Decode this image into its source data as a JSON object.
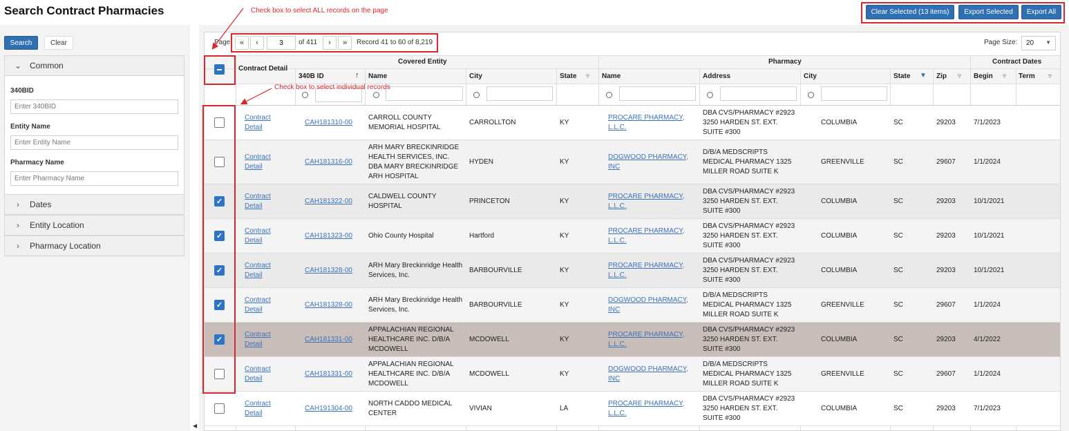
{
  "page": {
    "title": "Search Contract Pharmacies"
  },
  "toolbar": {
    "clear_selected": "Clear Selected (13 items)",
    "export_selected": "Export Selected",
    "export_all": "Export All"
  },
  "sidebar": {
    "search_label": "Search",
    "clear_label": "Clear",
    "common_label": "Common",
    "fields": {
      "bid_label": "340BID",
      "bid_placeholder": "Enter 340BID",
      "entity_label": "Entity Name",
      "entity_placeholder": "Enter Entity Name",
      "pharmacy_label": "Pharmacy Name",
      "pharmacy_placeholder": "Enter Pharmacy Name"
    },
    "sections": [
      "Dates",
      "Entity Location",
      "Pharmacy Location"
    ]
  },
  "pager": {
    "page_label": "Page",
    "current_page": "3",
    "of_label": "of 411",
    "record_label": "Record 41 to 60 of 8,219",
    "page_size_label": "Page Size:",
    "page_size": "20"
  },
  "annotations": {
    "select_all": "Check box to select ALL records on the page",
    "select_individual": "Check box to select individual records"
  },
  "table": {
    "group_headers": {
      "contract_detail": "Contract Detail",
      "covered_entity": "Covered Entity",
      "pharmacy": "Pharmacy",
      "contract_dates": "Contract Dates"
    },
    "columns": {
      "id": "340B ID",
      "ce_name": "Name",
      "ce_city": "City",
      "ce_state": "State",
      "ph_name": "Name",
      "ph_address": "Address",
      "ph_city": "City",
      "ph_state": "State",
      "ph_zip": "Zip",
      "begin": "Begin",
      "term": "Term"
    },
    "rows": [
      {
        "checked": false,
        "detail": "Contract Detail",
        "id": "CAH181310-00",
        "ce_name": "CARROLL COUNTY MEMORIAL HOSPITAL",
        "ce_city": "CARROLLTON",
        "ce_state": "KY",
        "ph_name": "PROCARE PHARMACY, L.L.C.",
        "ph_address": "DBA CVS/PHARMACY #2923 3250 HARDEN ST. EXT. SUITE #300",
        "ph_city": "COLUMBIA",
        "ph_state": "SC",
        "zip": "29203",
        "begin": "7/1/2023",
        "term": ""
      },
      {
        "checked": false,
        "detail": "Contract Detail",
        "id": "CAH181316-00",
        "ce_name": "ARH MARY BRECKINRIDGE HEALTH SERVICES, INC. DBA MARY BRECKINRIDGE ARH HOSPITAL",
        "ce_city": "HYDEN",
        "ce_state": "KY",
        "ph_name": "DOGWOOD PHARMACY, INC",
        "ph_address": "D/B/A MEDSCRIPTS MEDICAL PHARMACY 1325 MILLER ROAD SUITE K",
        "ph_city": "GREENVILLE",
        "ph_state": "SC",
        "zip": "29607",
        "begin": "1/1/2024",
        "term": ""
      },
      {
        "checked": true,
        "detail": "Contract Detail",
        "id": "CAH181322-00",
        "ce_name": "CALDWELL COUNTY HOSPITAL",
        "ce_city": "PRINCETON",
        "ce_state": "KY",
        "ph_name": "PROCARE PHARMACY, L.L.C.",
        "ph_address": "DBA CVS/PHARMACY #2923 3250 HARDEN ST. EXT. SUITE #300",
        "ph_city": "COLUMBIA",
        "ph_state": "SC",
        "zip": "29203",
        "begin": "10/1/2021",
        "term": ""
      },
      {
        "checked": true,
        "detail": "Contract Detail",
        "id": "CAH181323-00",
        "ce_name": "Ohio County Hospital",
        "ce_city": "Hartford",
        "ce_state": "KY",
        "ph_name": "PROCARE PHARMACY, L.L.C.",
        "ph_address": "DBA CVS/PHARMACY #2923 3250 HARDEN ST. EXT. SUITE #300",
        "ph_city": "COLUMBIA",
        "ph_state": "SC",
        "zip": "29203",
        "begin": "10/1/2021",
        "term": ""
      },
      {
        "checked": true,
        "detail": "Contract Detail",
        "id": "CAH181328-00",
        "ce_name": "ARH Mary Breckinridge Health Services, Inc.",
        "ce_city": "BARBOURVILLE",
        "ce_state": "KY",
        "ph_name": "PROCARE PHARMACY, L.L.C.",
        "ph_address": "DBA CVS/PHARMACY #2923 3250 HARDEN ST. EXT. SUITE #300",
        "ph_city": "COLUMBIA",
        "ph_state": "SC",
        "zip": "29203",
        "begin": "10/1/2021",
        "term": ""
      },
      {
        "checked": true,
        "detail": "Contract Detail",
        "id": "CAH181328-00",
        "ce_name": "ARH Mary Breckinridge Health Services, Inc.",
        "ce_city": "BARBOURVILLE",
        "ce_state": "KY",
        "ph_name": "DOGWOOD PHARMACY, INC",
        "ph_address": "D/B/A MEDSCRIPTS MEDICAL PHARMACY 1325 MILLER ROAD SUITE K",
        "ph_city": "GREENVILLE",
        "ph_state": "SC",
        "zip": "29607",
        "begin": "1/1/2024",
        "term": ""
      },
      {
        "checked": true,
        "detail": "Contract Detail",
        "id": "CAH181331-00",
        "ce_name": "APPALACHIAN REGIONAL HEALTHCARE INC. D/B/A MCDOWELL",
        "ce_city": "MCDOWELL",
        "ce_state": "KY",
        "ph_name": "PROCARE PHARMACY, L.L.C.",
        "ph_address": "DBA CVS/PHARMACY #2923 3250 HARDEN ST. EXT. SUITE #300",
        "ph_city": "COLUMBIA",
        "ph_state": "SC",
        "zip": "29203",
        "begin": "4/1/2022",
        "term": ""
      },
      {
        "checked": false,
        "detail": "Contract Detail",
        "id": "CAH181331-00",
        "ce_name": "APPALACHIAN REGIONAL HEALTHCARE INC. D/B/A MCDOWELL",
        "ce_city": "MCDOWELL",
        "ce_state": "KY",
        "ph_name": "DOGWOOD PHARMACY, INC",
        "ph_address": "D/B/A MEDSCRIPTS MEDICAL PHARMACY 1325 MILLER ROAD SUITE K",
        "ph_city": "GREENVILLE",
        "ph_state": "SC",
        "zip": "29607",
        "begin": "1/1/2024",
        "term": ""
      },
      {
        "checked": false,
        "detail": "Contract Detail",
        "id": "CAH191304-00",
        "ce_name": "NORTH CADDO MEDICAL CENTER",
        "ce_city": "VIVIAN",
        "ce_state": "LA",
        "ph_name": "PROCARE PHARMACY, L.L.C.",
        "ph_address": "DBA CVS/PHARMACY #2923 3250 HARDEN ST. EXT. SUITE #300",
        "ph_city": "COLUMBIA",
        "ph_state": "SC",
        "zip": "29203",
        "begin": "7/1/2023",
        "term": ""
      }
    ]
  },
  "colors": {
    "accent": "#2f6fb2",
    "annotation": "#d9262c",
    "row_alt": "#f2f2f2",
    "row_selected": "#c9bdb9"
  }
}
